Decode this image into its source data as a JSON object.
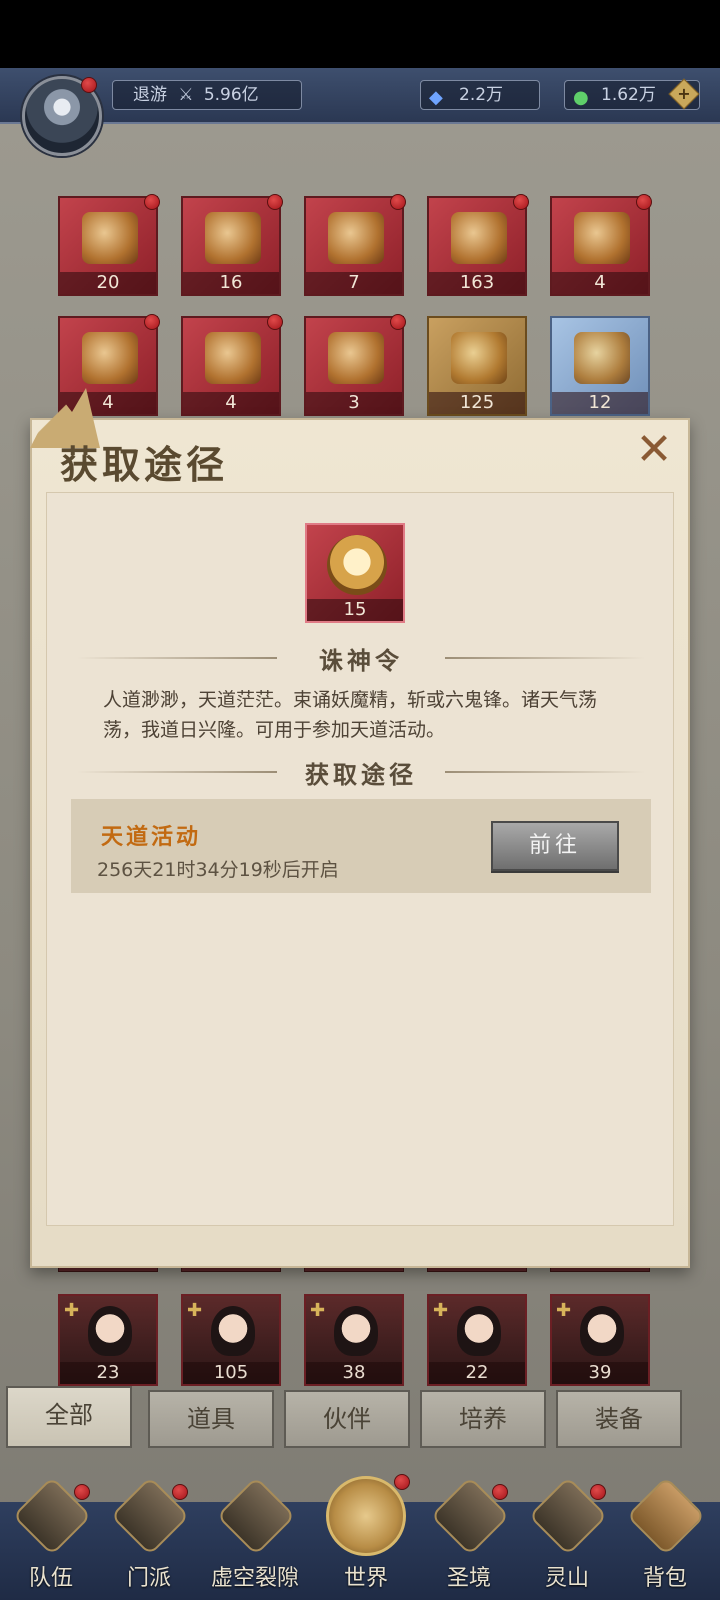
{
  "topbar": {
    "player_name": "退游",
    "power": "5.96亿",
    "crystal": "2.2万",
    "jade": "1.62万"
  },
  "bag_items": [
    {
      "count": "20"
    },
    {
      "count": "16"
    },
    {
      "count": "7"
    },
    {
      "count": "163"
    },
    {
      "count": "4"
    },
    {
      "count": "4"
    },
    {
      "count": "4"
    },
    {
      "count": "3"
    },
    {
      "count": "125"
    },
    {
      "count": "12"
    }
  ],
  "partner_cards": [
    {
      "count": "23"
    },
    {
      "count": "105"
    },
    {
      "count": "38"
    },
    {
      "count": "22"
    },
    {
      "count": "39"
    }
  ],
  "tabs": [
    "全部",
    "道具",
    "伙伴",
    "培养",
    "装备"
  ],
  "nav": [
    "队伍",
    "门派",
    "虚空裂隙",
    "世界",
    "圣境",
    "灵山",
    "背包"
  ],
  "popup": {
    "title": "获取途径",
    "item_count": "15",
    "item_name": "诛神令",
    "description": "人道渺渺，天道茫茫。束诵妖魔精，斩或六鬼锋。诸天气荡荡，我道日兴隆。可用于参加天道活动。",
    "section_title": "获取途径",
    "source_name": "天道活动",
    "source_time": "256天21时34分19秒后开启",
    "go_label": "前往"
  }
}
